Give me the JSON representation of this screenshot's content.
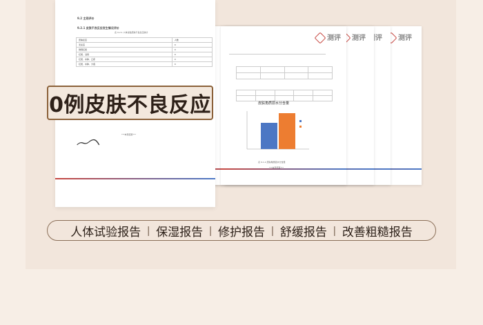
{
  "banner": {
    "text": "0例皮肤不良反应"
  },
  "caption": {
    "items": [
      "人体试验报告",
      "保湿报告",
      "修护报告",
      "舒缓报告",
      "改善粗糙报告"
    ]
  },
  "doc_main": {
    "heading": "9.2 主观评价",
    "subheading": "9.2.1 皮肤不良反应发生情况评价",
    "table_title": "表 9.2.1 人体试验皮肤不良反应统计",
    "table_col1": "皮肤反应",
    "table_col2": "人数",
    "rows": [
      {
        "label": "无反应",
        "value": "0"
      },
      {
        "label": "微弱红斑",
        "value": "0"
      },
      {
        "label": "红斑、浸润",
        "value": "0"
      },
      {
        "label": "红斑、水肿、丘疹",
        "value": "0"
      },
      {
        "label": "红斑、水肿、大疱",
        "value": "0"
      }
    ],
    "end_note": "***本页结束***"
  },
  "doc_stack": {
    "logo_text": "测评",
    "chart_title": "皮肤角质层水分含量",
    "chart_note": "表 9.1.2 皮肤角质层水分含量",
    "end_note": "***本页结束***"
  },
  "colors": {
    "accent_red": "#c7463f",
    "accent_blue": "#4a78c7",
    "bar_blue": "#4c77c4",
    "bar_orange": "#ed7d31"
  }
}
